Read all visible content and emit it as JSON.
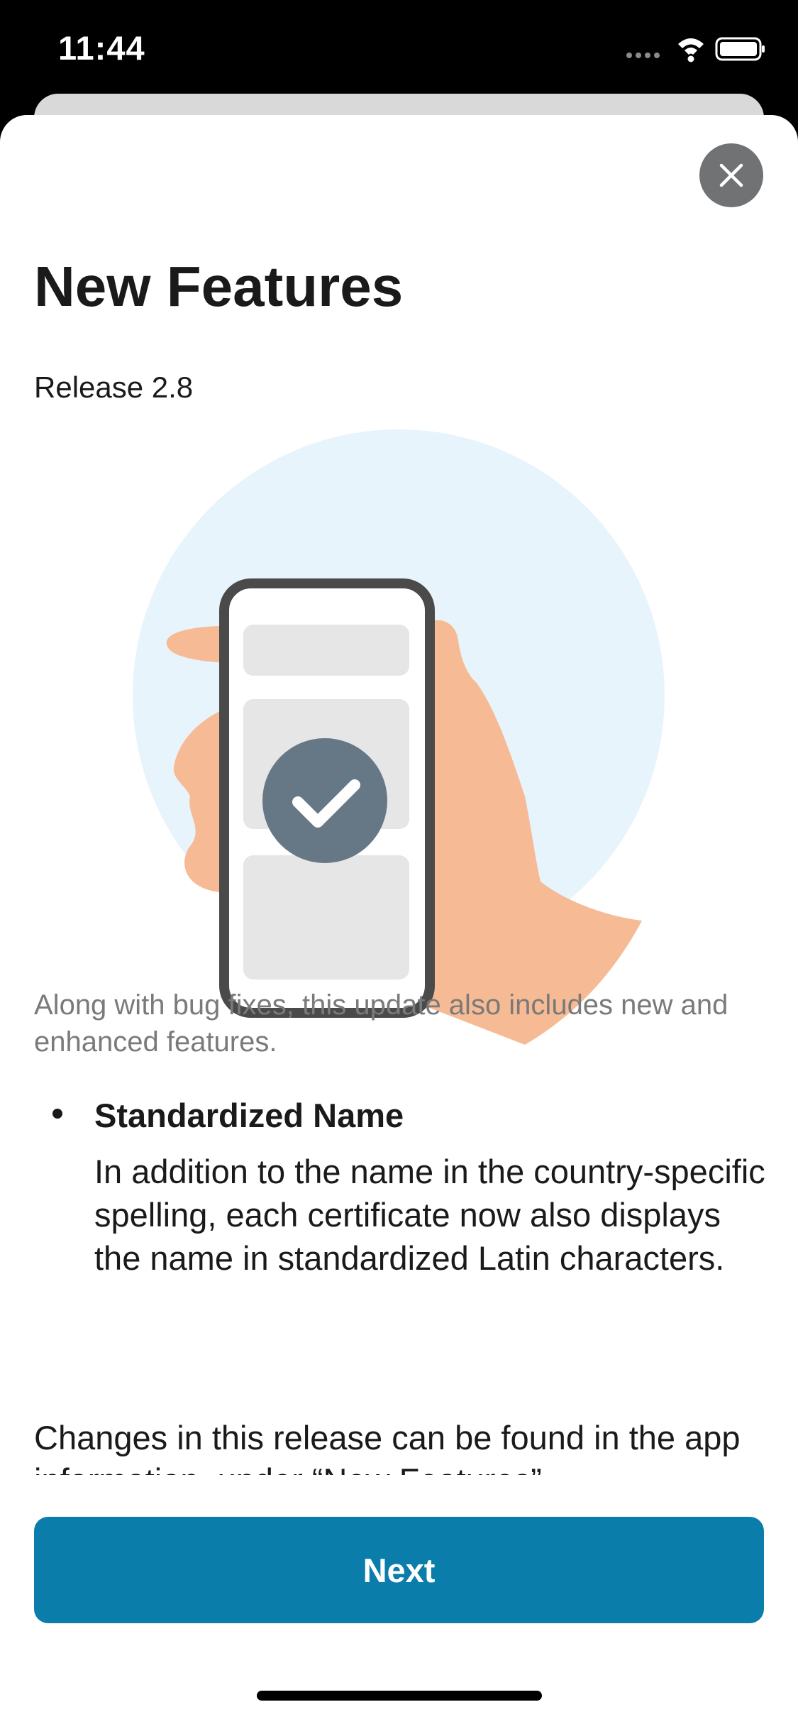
{
  "status_bar": {
    "time": "11:44",
    "icons": [
      "signal-dots-icon",
      "wifi-icon",
      "battery-icon"
    ]
  },
  "sheet": {
    "close_icon": "close-icon",
    "title": "New Features",
    "release": "Release 2.8",
    "illustration_icons": [
      "phone-in-hand-illustration",
      "checkmark-icon"
    ],
    "intro": "Along with bug fixes, this update also includes new and enhanced features.",
    "features": [
      {
        "title": "Standardized Name",
        "description": "In addition to the name in the country-specific spelling, each certificate now also displays the name in standardized Latin characters."
      }
    ],
    "changes_text": "Changes in this release can be found in the app information, under “New Features”.",
    "next_label": "Next"
  },
  "colors": {
    "primary_button": "#0a7dab",
    "circle_background": "#e8f4fc",
    "check_badge": "#667786",
    "hand": "#f6bb94",
    "phone_frame": "#4a4a4a"
  }
}
